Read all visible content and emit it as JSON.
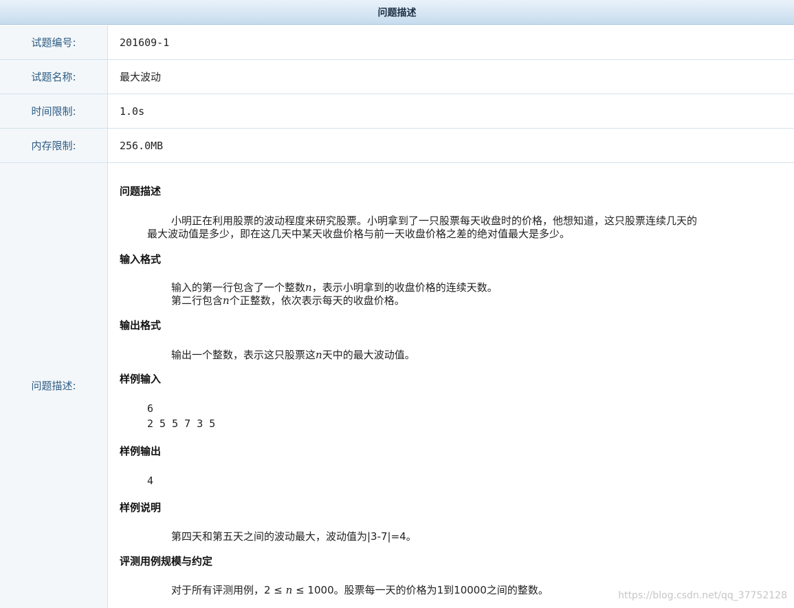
{
  "header": {
    "title": "问题描述"
  },
  "rows": [
    {
      "label": "试题编号:",
      "value": "201609-1"
    },
    {
      "label": "试题名称:",
      "value": "最大波动"
    },
    {
      "label": "时间限制:",
      "value": "1.0s"
    },
    {
      "label": "内存限制:",
      "value": "256.0MB"
    }
  ],
  "problem": {
    "label": "问题描述:",
    "description_title": "问题描述",
    "description_line1": "小明正在利用股票的波动程度来研究股票。小明拿到了一只股票每天收盘时的价格，他想知道，这只股票连续几天的",
    "description_line2": "最大波动值是多少，即在这几天中某天收盘价格与前一天收盘价格之差的绝对值最大是多少。",
    "input_title": "输入格式",
    "input_line1_a": "输入的第一行包含了一个整数",
    "input_line1_var": "n",
    "input_line1_b": "，表示小明拿到的收盘价格的连续天数。",
    "input_line2_a": "第二行包含",
    "input_line2_var": "n",
    "input_line2_b": "个正整数，依次表示每天的收盘价格。",
    "output_title": "输出格式",
    "output_line_a": "输出一个整数，表示这只股票这",
    "output_line_var": "n",
    "output_line_b": "天中的最大波动值。",
    "sample_input_title": "样例输入",
    "sample_input_line1": "6",
    "sample_input_line2": "2 5 5 7 3 5",
    "sample_output_title": "样例输出",
    "sample_output_line": "4",
    "sample_explain_title": "样例说明",
    "sample_explain_line": "第四天和第五天之间的波动最大，波动值为|3-7|=4。",
    "limits_title": "评测用例规模与约定",
    "limits_line_a": "对于所有评测用例，2 ≤ ",
    "limits_line_var": "n",
    "limits_line_b": " ≤ 1000。股票每一天的价格为1到10000之间的整数。"
  },
  "watermark": "https://blog.csdn.net/qq_37752128"
}
